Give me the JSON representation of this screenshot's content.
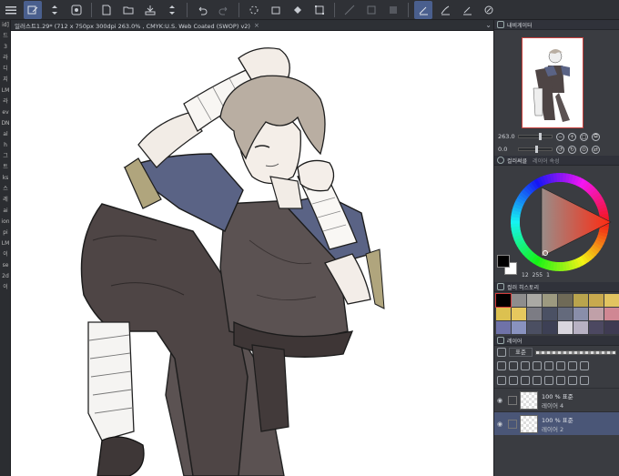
{
  "toolbar": {
    "items": [
      "menu-icon",
      "tool-icon",
      "arrows-icon",
      "view-icon",
      "new-icon",
      "open-icon",
      "save-icon",
      "arrows2-icon",
      "undo-icon",
      "redo-icon",
      "loading-icon",
      "fill-icon",
      "fill2-icon",
      "transform-icon",
      "ruler-icon",
      "snap-icon",
      "frame-icon",
      "pen-icon",
      "brush-icon",
      "ink-icon",
      "layer-icon"
    ]
  },
  "left_strip": {
    "items": [
      "id]",
      "드",
      "3",
      "라",
      "디",
      "지",
      "LM",
      "라",
      "ev",
      "DN",
      "al",
      "h",
      "그",
      "트",
      "ks",
      "스",
      "레",
      "ai",
      "ion",
      "pi",
      "LM",
      "이",
      "se",
      "2d",
      "이"
    ]
  },
  "canvas_tab": {
    "title": "일러스트1.29* (712 x 750px 300dpi 263.0% , CMYK:U.S. Web Coated (SWOP) v2)",
    "close": "×",
    "menu": "⌄"
  },
  "navigator": {
    "title": "내비게이터",
    "zoom": "263.0",
    "rotation": "0.0"
  },
  "color": {
    "tab_active": "컬러써클",
    "tab_inactive": "레이어 속성",
    "footer": [
      "12",
      "255",
      "1"
    ],
    "fg": "#000000",
    "bg": "#ffffff"
  },
  "history": {
    "title": "컬러 히스토리",
    "swatches": [
      "#000000",
      "#8e8d8d",
      "#aaa9a4",
      "#9d9a80",
      "#6f6a57",
      "#b9a44d",
      "#c8a94e",
      "#e2c460",
      "#dcc150",
      "#e6c85e",
      "#7c7c84",
      "#4b5164",
      "#646a7c",
      "#898eaa",
      "#c0a0a8",
      "#d08793",
      "#6f72a8",
      "#8992bf",
      "#4b4f62",
      "#3d4055",
      "#d9d6de",
      "#b7b1c3",
      "#4c4861",
      "#3f3b52"
    ]
  },
  "layers": {
    "title": "레이어",
    "blend_mode": "표준",
    "items": [
      {
        "opacity": "100 %  표준",
        "name": "레이어 4",
        "selected": false
      },
      {
        "opacity": "100 %  표준",
        "name": "레이어 2",
        "selected": true
      }
    ]
  }
}
